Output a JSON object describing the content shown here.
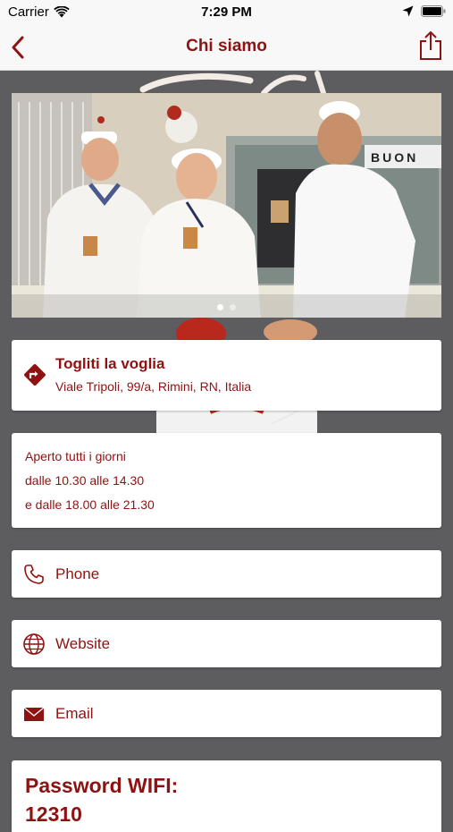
{
  "status_bar": {
    "carrier": "Carrier",
    "time": "7:29 PM",
    "icons": [
      "wifi-icon",
      "location-arrow-icon",
      "battery-icon"
    ]
  },
  "nav": {
    "title": "Chi siamo",
    "back_icon": "chevron-left-icon",
    "share_icon": "share-icon"
  },
  "hero": {
    "image": "photo of three staff members in white chef uniforms raising small glasses",
    "sign_text": "BUON",
    "page_count": 2,
    "active_page": 1
  },
  "address": {
    "icon": "directions-icon",
    "name": "Togliti la voglia",
    "line": "Viale Tripoli, 99/a, Rimini, RN, Italia"
  },
  "hours": {
    "lines": [
      "Aperto tutti i giorni",
      "dalle 10.30 alle 14.30",
      "e dalle 18.00 alle 21.30"
    ]
  },
  "links": [
    {
      "icon": "phone-icon",
      "label": "Phone"
    },
    {
      "icon": "globe-icon",
      "label": "Website"
    },
    {
      "icon": "envelope-icon",
      "label": "Email"
    }
  ],
  "wifi": {
    "title": "Password WIFI:",
    "value": "12310"
  },
  "colors": {
    "accent": "#8f1212",
    "background": "#5d5d5f",
    "bar": "#f8f8f8"
  }
}
